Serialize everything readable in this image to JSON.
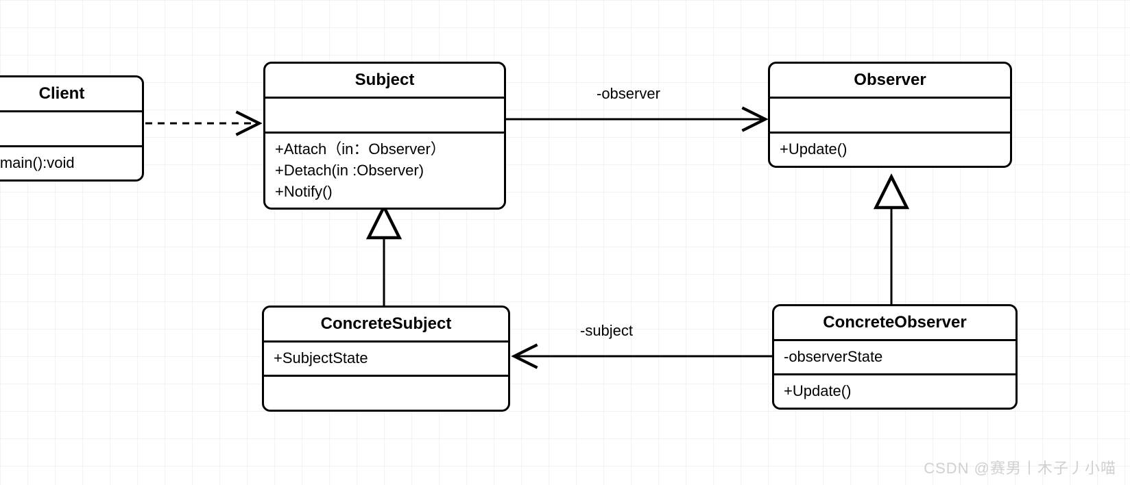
{
  "classes": {
    "client": {
      "name": "Client",
      "ops": [
        "+main():void"
      ]
    },
    "subject": {
      "name": "Subject",
      "ops": [
        "+Attach（in：Observer）",
        "+Detach(in :Observer)",
        "+Notify()"
      ]
    },
    "observer": {
      "name": "Observer",
      "ops": [
        "+Update()"
      ]
    },
    "concreteSubject": {
      "name": "ConcreteSubject",
      "attrs": [
        "+SubjectState"
      ]
    },
    "concreteObserver": {
      "name": "ConcreteObserver",
      "attrs": [
        "-observerState"
      ],
      "ops": [
        "+Update()"
      ]
    }
  },
  "labels": {
    "observer": "-observer",
    "subject": "-subject"
  },
  "watermark": "CSDN @赛男丨木子丿小喵"
}
